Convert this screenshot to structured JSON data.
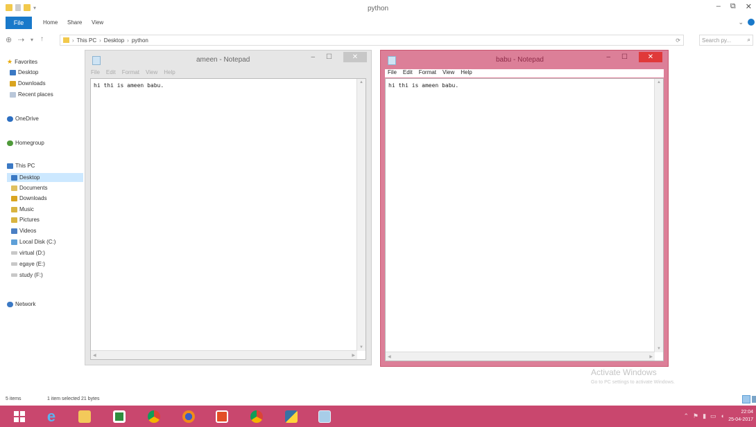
{
  "explorer": {
    "title": "python",
    "window_controls": {
      "minimize": "–",
      "restore": "⧉",
      "close": "✕"
    },
    "ribbon_tabs": [
      "File",
      "Home",
      "Share",
      "View"
    ],
    "breadcrumb": [
      "This PC",
      "Desktop",
      "python"
    ],
    "search_placeholder": "Search py...",
    "nav": {
      "favorites_label": "Favorites",
      "favorites": [
        "Desktop",
        "Downloads",
        "Recent places"
      ],
      "onedrive": "OneDrive",
      "homegroup": "Homegroup",
      "thispc": "This PC",
      "thispc_items": [
        "Desktop",
        "Documents",
        "Downloads",
        "Music",
        "Pictures",
        "Videos",
        "Local Disk (C:)",
        "virtual (D:)",
        "egaye (E:)",
        "study (F:)"
      ],
      "network": "Network"
    },
    "status": {
      "items": "5 items",
      "selected": "1 item selected  21 bytes"
    }
  },
  "notepad1": {
    "title": "ameen - Notepad",
    "menu": [
      "File",
      "Edit",
      "Format",
      "View",
      "Help"
    ],
    "content": "hi thi is ameen babu."
  },
  "notepad2": {
    "title": "babu - Notepad",
    "menu": [
      "File",
      "Edit",
      "Format",
      "View",
      "Help"
    ],
    "content": "hi thi is ameen babu."
  },
  "watermark": {
    "title": "Activate Windows",
    "subtitle": "Go to PC settings to activate Windows."
  },
  "taskbar": {
    "apps": [
      "start-icon",
      "internet-explorer-icon",
      "file-explorer-icon",
      "store-icon",
      "chrome-icon",
      "firefox-icon",
      "office-icon",
      "chrome-icon-2",
      "python-icon",
      "notepad-icon"
    ],
    "clock_time": "22:04",
    "clock_date": "25-04-2017"
  },
  "colors": {
    "accent": "#1979ca",
    "taskbar": "#c9476e",
    "active_window": "#dc7f98"
  }
}
